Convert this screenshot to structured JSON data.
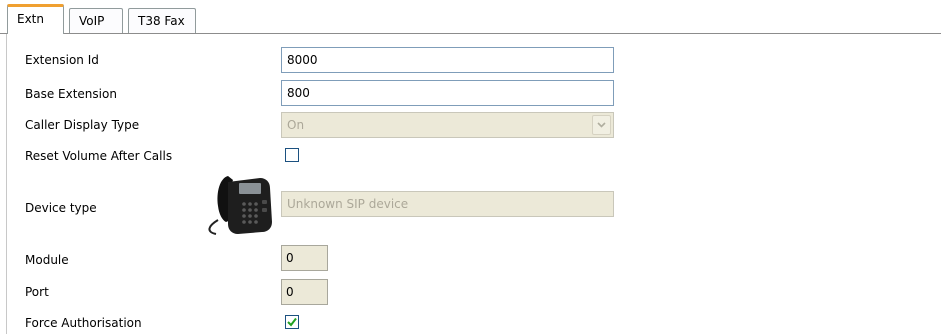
{
  "tabs": [
    {
      "label": "Extn",
      "active": true
    },
    {
      "label": "VoIP",
      "active": false
    },
    {
      "label": "T38 Fax",
      "active": false
    }
  ],
  "form": {
    "extension_id": {
      "label": "Extension Id",
      "value": "8000"
    },
    "base_extension": {
      "label": "Base Extension",
      "value": "800"
    },
    "caller_display_type": {
      "label": "Caller Display Type",
      "value": "On",
      "disabled": true
    },
    "reset_volume": {
      "label": "Reset Volume After Calls",
      "checked": false
    },
    "device_type": {
      "label": "Device type",
      "value": "Unknown SIP device",
      "disabled": true,
      "icon": "desk-phone-icon"
    },
    "module": {
      "label": "Module",
      "value": "0"
    },
    "port": {
      "label": "Port",
      "value": "0"
    },
    "force_authorisation": {
      "label": "Force Authorisation",
      "checked": true
    }
  },
  "colors": {
    "active_tab_accent": "#f0a030",
    "input_border": "#7f9db9",
    "disabled_bg": "#ece9d8",
    "checkbox_border": "#1c5180",
    "checkmark": "#21a121"
  }
}
